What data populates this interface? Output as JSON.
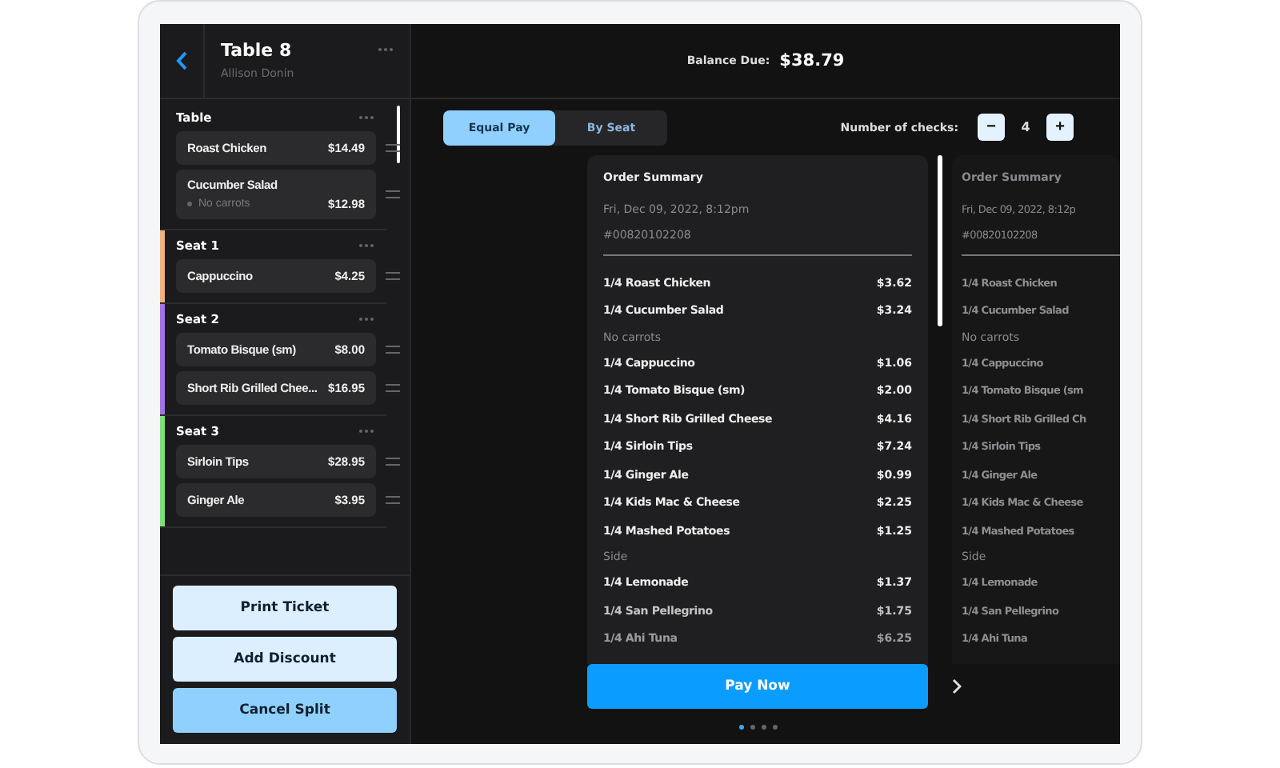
{
  "order": {
    "title": "Table 8",
    "server": "Allison Donin"
  },
  "sections": [
    {
      "name": "Table",
      "items": [
        {
          "name": "Roast Chicken",
          "price": "$14.49"
        },
        {
          "name": "Cucumber Salad",
          "price": "$12.98",
          "note": "No carrots"
        }
      ]
    },
    {
      "name": "Seat 1",
      "color": "#f2b27e",
      "items": [
        {
          "name": "Cappuccino",
          "price": "$4.25"
        }
      ]
    },
    {
      "name": "Seat 2",
      "color": "#a173e6",
      "items": [
        {
          "name": "Tomato Bisque (sm)",
          "price": "$8.00"
        },
        {
          "name": "Short Rib Grilled Chee...",
          "price": "$16.95"
        }
      ]
    },
    {
      "name": "Seat 3",
      "color": "#7fe07a",
      "items": [
        {
          "name": "Sirloin Tips",
          "price": "$28.95"
        },
        {
          "name": "Ginger Ale",
          "price": "$3.95"
        }
      ]
    }
  ],
  "actions": [
    {
      "label": "Print Ticket",
      "kind": "secondary"
    },
    {
      "label": "Add Discount",
      "kind": "secondary"
    },
    {
      "label": "Cancel Split",
      "kind": "primary"
    }
  ],
  "balance": {
    "label": "Balance Due:",
    "amount": "$38.79"
  },
  "split_tabs": [
    {
      "label": "Equal Pay",
      "selected": true
    },
    {
      "label": "By Seat",
      "selected": false
    }
  ],
  "checks_count": {
    "label": "Number of checks:",
    "value": "4",
    "minus": "−",
    "plus": "+"
  },
  "checks": [
    {
      "title": "Order Summary",
      "date": "Fri, Dec 09, 2022, 8:12pm",
      "number": "#00820102208",
      "lines": [
        {
          "name": "1/4 Roast Chicken",
          "price": "$3.62"
        },
        {
          "name": "1/4 Cucumber Salad",
          "price": "$3.24",
          "note": "No carrots"
        },
        {
          "name": "1/4 Cappuccino",
          "price": "$1.06"
        },
        {
          "name": "1/4 Tomato Bisque (sm)",
          "price": "$2.00"
        },
        {
          "name": "1/4 Short Rib Grilled Cheese",
          "price": "$4.16"
        },
        {
          "name": "1/4 Sirloin Tips",
          "price": "$7.24"
        },
        {
          "name": "1/4 Ginger Ale",
          "price": "$0.99"
        },
        {
          "name": "1/4 Kids Mac & Cheese",
          "price": "$2.25"
        },
        {
          "name": "1/4 Mashed Potatoes",
          "price": "$1.25",
          "note": "Side"
        },
        {
          "name": "1/4 Lemonade",
          "price": "$1.37"
        },
        {
          "name": "1/4 San Pellegrino",
          "price": "$1.75"
        },
        {
          "name": "1/4 Ahi Tuna",
          "price": "$6.25"
        }
      ]
    },
    {
      "title": "Order Summary",
      "date": "Fri, Dec 09, 2022, 8:12p",
      "number": "#00820102208",
      "lines": [
        {
          "name": "1/4 Roast Chicken"
        },
        {
          "name": "1/4 Cucumber Salad",
          "note": "No carrots"
        },
        {
          "name": "1/4 Cappuccino"
        },
        {
          "name": "1/4 Tomato Bisque (sm"
        },
        {
          "name": "1/4 Short Rib Grilled Ch"
        },
        {
          "name": "1/4 Sirloin Tips"
        },
        {
          "name": "1/4 Ginger Ale"
        },
        {
          "name": "1/4 Kids Mac & Cheese"
        },
        {
          "name": "1/4 Mashed Potatoes",
          "note": "Side"
        },
        {
          "name": "1/4 Lemonade"
        },
        {
          "name": "1/4 San Pellegrino"
        },
        {
          "name": "1/4 Ahi Tuna"
        }
      ]
    }
  ],
  "pay_button": "Pay Now",
  "pages": [
    {
      "selected": true
    },
    {
      "selected": false
    },
    {
      "selected": false
    },
    {
      "selected": false
    }
  ]
}
